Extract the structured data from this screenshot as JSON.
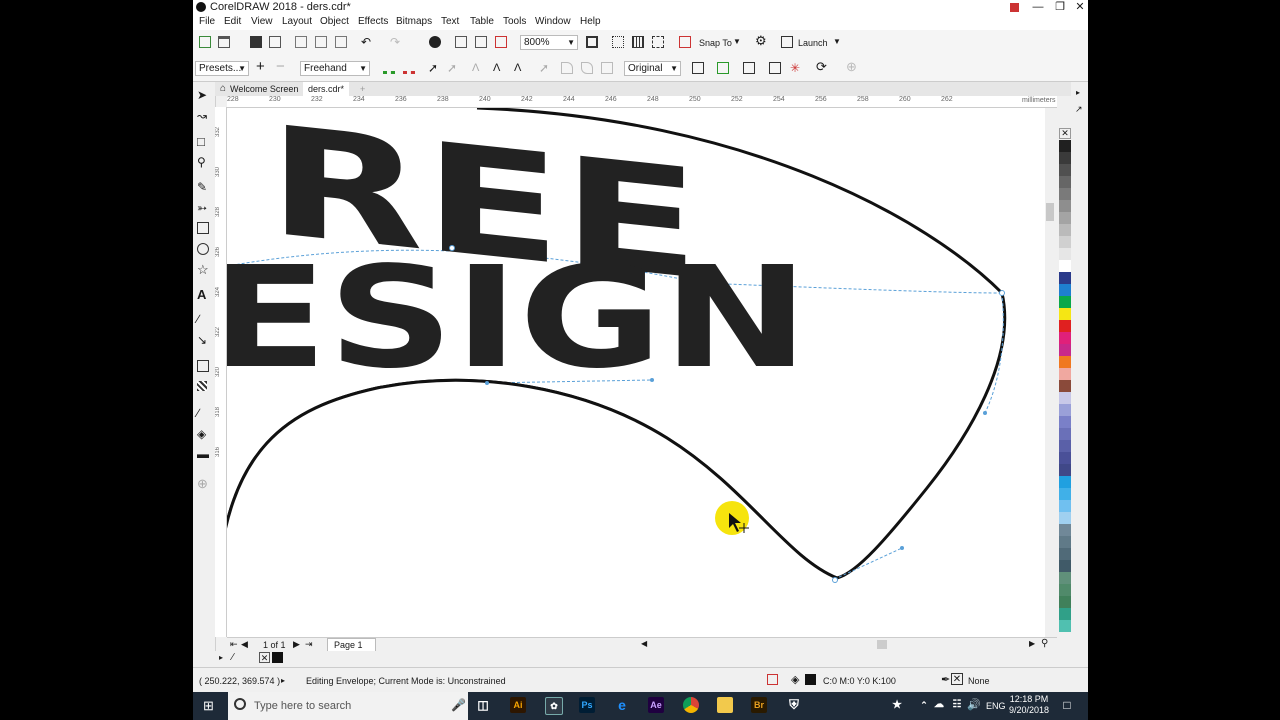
{
  "window": {
    "title": "CorelDRAW 2018 - ders.cdr*",
    "controls": [
      "minimize",
      "restore",
      "close"
    ]
  },
  "menu": [
    "File",
    "Edit",
    "View",
    "Layout",
    "Object",
    "Effects",
    "Bitmaps",
    "Text",
    "Table",
    "Tools",
    "Window",
    "Help"
  ],
  "toolbar": {
    "zoom": "800%",
    "snap_to": "Snap To",
    "launch": "Launch"
  },
  "property_bar": {
    "presets": "Presets...",
    "mode": "Freehand",
    "mapping": "Original"
  },
  "tabs": [
    {
      "label": "Welcome Screen",
      "active": false
    },
    {
      "label": "ders.cdr*",
      "active": true
    }
  ],
  "ruler": {
    "units": "millimeters",
    "h_ticks": [
      "228",
      "230",
      "232",
      "234",
      "236",
      "238",
      "240",
      "242",
      "244",
      "246",
      "248",
      "250",
      "252",
      "254",
      "256",
      "258",
      "260",
      "262"
    ],
    "v_ticks": [
      "332",
      "330",
      "328",
      "326",
      "324",
      "322",
      "320",
      "318",
      "316"
    ]
  },
  "canvas": {
    "artwork_text_line1": "REE",
    "artwork_text_line2": "ESIGN"
  },
  "page_nav": {
    "page_count": "1 of 1",
    "page_tab": "Page 1"
  },
  "status": {
    "coords": "( 250.222, 369.574 )",
    "message": "Editing Envelope; Current Mode is: Unconstrained",
    "fill": "C:0 M:0 Y:0 K:100",
    "outline": "None"
  },
  "taskbar": {
    "search_placeholder": "Type here to search",
    "apps": [
      "Task View",
      "Illustrator",
      "CorelDRAW",
      "Photoshop",
      "Edge",
      "After Effects",
      "Chrome",
      "File Explorer",
      "Bridge",
      "Security"
    ],
    "language": "ENG",
    "time": "12:18 PM",
    "date": "9/20/2018"
  },
  "palette_colors": [
    "#202020",
    "#3a3a3a",
    "#505050",
    "#666666",
    "#7a7a7a",
    "#8e8e8e",
    "#a4a4a4",
    "#bababa",
    "#d0d0d0",
    "#e6e6e6",
    "#ffffff",
    "#2a3a8a",
    "#1e7fd0",
    "#0aa84a",
    "#f5e614",
    "#e02020",
    "#e0207a",
    "#c8288a",
    "#f07820",
    "#f0a8a0",
    "#8a4a3a",
    "#c8c8e8",
    "#9aa0d8",
    "#7a80c8",
    "#6a70b8",
    "#5a60a8",
    "#4a5098",
    "#404888",
    "#20a0e0",
    "#40b0e8",
    "#70c0f0",
    "#a0d0f0",
    "#708898",
    "#607a88",
    "#506a78",
    "#405a68",
    "#60907a",
    "#508a6a",
    "#40805a",
    "#30a088",
    "#50c0b0"
  ]
}
